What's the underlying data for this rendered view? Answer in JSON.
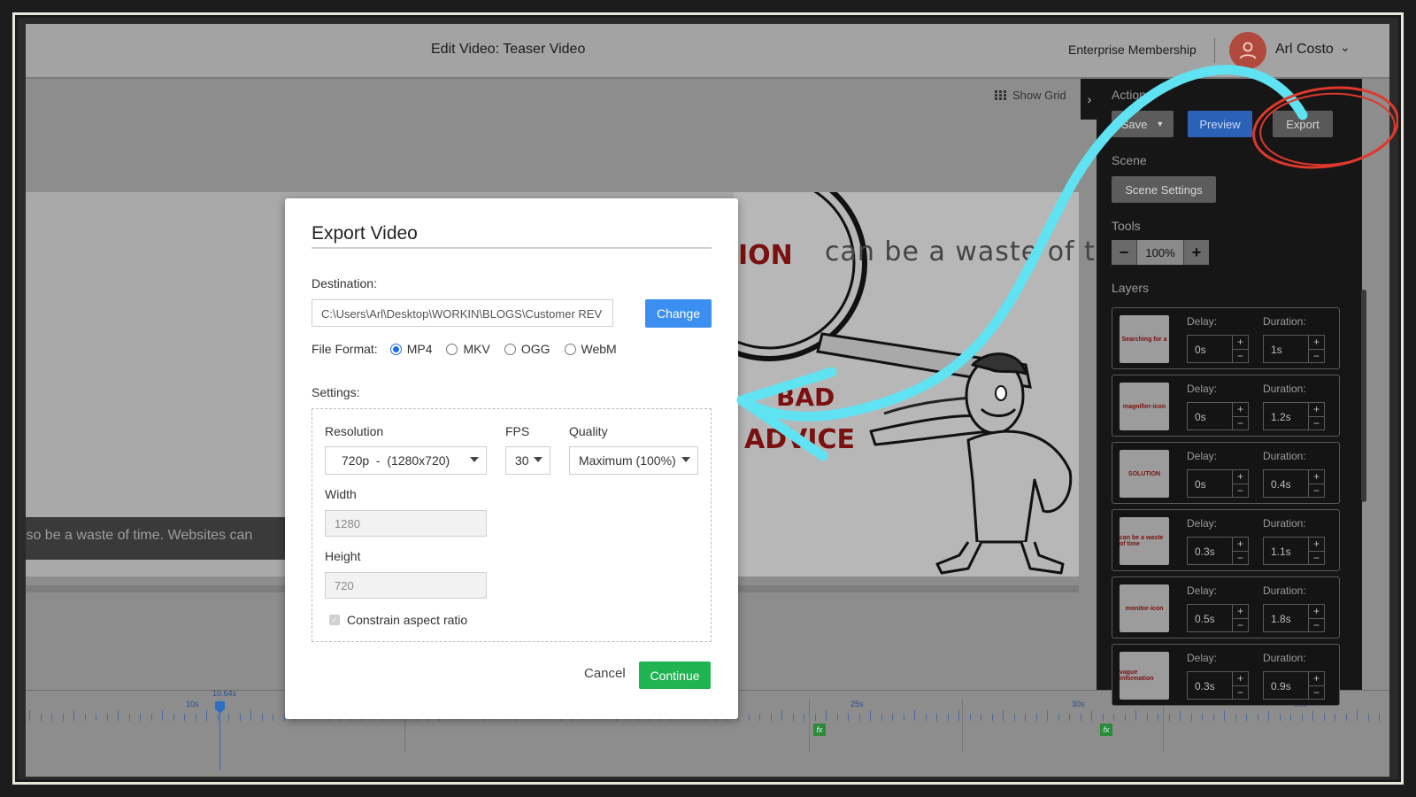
{
  "header": {
    "title": "Edit Video: Teaser Video",
    "membership": "Enterprise Membership",
    "user_name": "Arl Costo"
  },
  "canvas": {
    "show_grid_label": "Show Grid",
    "scene_text": "can be a waste of time",
    "scene_word_solution": "ION",
    "scene_word_bad": "BAD",
    "scene_word_advice": "ADVICE",
    "caption": "also be a waste of time. Websites can"
  },
  "panel": {
    "actions_label": "Actions",
    "save_label": "Save",
    "preview_label": "Preview",
    "export_label": "Export",
    "scene_label": "Scene",
    "scene_settings_label": "Scene Settings",
    "tools_label": "Tools",
    "zoom_value": "100%",
    "layers_label": "Layers",
    "delay_label": "Delay:",
    "duration_label": "Duration:",
    "layers": [
      {
        "thumb": "Searching for a",
        "delay": "0s",
        "duration": "1s"
      },
      {
        "thumb": "magnifier-icon",
        "delay": "0s",
        "duration": "1.2s"
      },
      {
        "thumb": "SOLUTION",
        "delay": "0s",
        "duration": "0.4s"
      },
      {
        "thumb": "can be a waste of time",
        "delay": "0.3s",
        "duration": "1.1s"
      },
      {
        "thumb": "monitor-icon",
        "delay": "0.5s",
        "duration": "1.8s"
      },
      {
        "thumb": "vague information",
        "delay": "0.3s",
        "duration": "0.9s"
      }
    ]
  },
  "timeline": {
    "playhead_label": "10.64s",
    "tick_labels": [
      "10s",
      "25s",
      "30s",
      "35s"
    ]
  },
  "modal": {
    "title": "Export Video",
    "destination_label": "Destination:",
    "destination_value": "C:\\Users\\Arl\\Desktop\\WORKIN\\BLOGS\\Customer REV",
    "change_label": "Change",
    "file_format_label": "File Format:",
    "formats": [
      "MP4",
      "MKV",
      "OGG",
      "WebM"
    ],
    "selected_format": "MP4",
    "settings_label": "Settings:",
    "resolution_label": "Resolution",
    "resolution_value": "720p  -  (1280x720)",
    "fps_label": "FPS",
    "fps_value": "30",
    "quality_label": "Quality",
    "quality_value": "Maximum (100%)",
    "width_label": "Width",
    "width_value": "1280",
    "height_label": "Height",
    "height_value": "720",
    "constrain_label": "Constrain aspect ratio",
    "cancel_label": "Cancel",
    "continue_label": "Continue"
  },
  "colors": {
    "accent_blue": "#3b8ff0",
    "continue_green": "#20b352",
    "annotation_cyan": "#5fe3f2",
    "annotation_red": "#e0382b"
  }
}
